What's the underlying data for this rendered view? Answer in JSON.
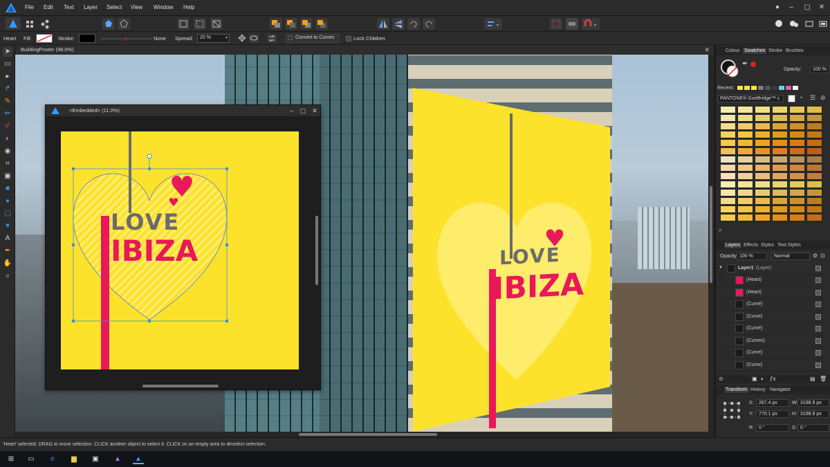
{
  "menubar": {
    "items": [
      "File",
      "Edit",
      "Text",
      "Layer",
      "Select",
      "View",
      "Window",
      "Help"
    ]
  },
  "context": {
    "object_name": "Heart",
    "fill_label": "Fill:",
    "stroke_label": "Stroke:",
    "stroke_value": "None",
    "spread_label": "Spread:",
    "spread_value": "20 %",
    "convert_button": "Convert to Curves",
    "lock_children": "Lock Children"
  },
  "document": {
    "title": "BuildingPoster (98.0%)"
  },
  "embedded": {
    "title": "<Embedded> (11.0%)"
  },
  "poster": {
    "line1": "LOVE",
    "line2": "IBIZA"
  },
  "colour_panel": {
    "tabs": [
      "Colour",
      "Swatches",
      "Stroke",
      "Brushes"
    ],
    "active_tab": "Swatches",
    "opacity_label": "Opacity:",
    "opacity_value": "100 %",
    "recent_label": "Recent:",
    "palette_name": "PANTONE® GoeBridge™ c",
    "recent_colors": [
      "#f2e94e",
      "#f6e742",
      "#f7e236",
      "#7a7a7a",
      "#555555",
      "#3a3a3a",
      "#62d6e0",
      "#e35bc0",
      "#f5f5f5"
    ]
  },
  "layers_panel": {
    "tabs": [
      "Layers",
      "Effects",
      "Styles",
      "Text Styles"
    ],
    "active_tab": "Layers",
    "opacity_label": "Opacity:",
    "opacity_value": "100 %",
    "blend_mode": "Normal",
    "root_layer": "Layer1",
    "root_type": "(Layer)",
    "layers": [
      "(Heart)",
      "(Heart)",
      "(Curve)",
      "(Curve)",
      "(Curve)",
      "(Curves)",
      "(Curve)",
      "(Curve)"
    ]
  },
  "transform_panel": {
    "tabs": [
      "Transform",
      "History",
      "Navigator"
    ],
    "active_tab": "Transform",
    "x_label": "X:",
    "x_value": "267.4 px",
    "y_label": "Y:",
    "y_value": "770.1 px",
    "w_label": "W:",
    "w_value": "3198.9 px",
    "h_label": "H:",
    "h_value": "3198.9 px",
    "r_label": "R:",
    "r_value": "0 °",
    "s_label": "S:",
    "s_value": "0 °"
  },
  "status": {
    "message": "'Heart' selected. DRAG to move selection. CLICK another object to select it. CLICK on an empty area to deselect selection."
  },
  "colors": {
    "poster_yellow": "#fde22c",
    "brand_pink": "#e8185a",
    "logo_grey": "#6b6b6b",
    "accent_blue": "#3b8ee0"
  }
}
